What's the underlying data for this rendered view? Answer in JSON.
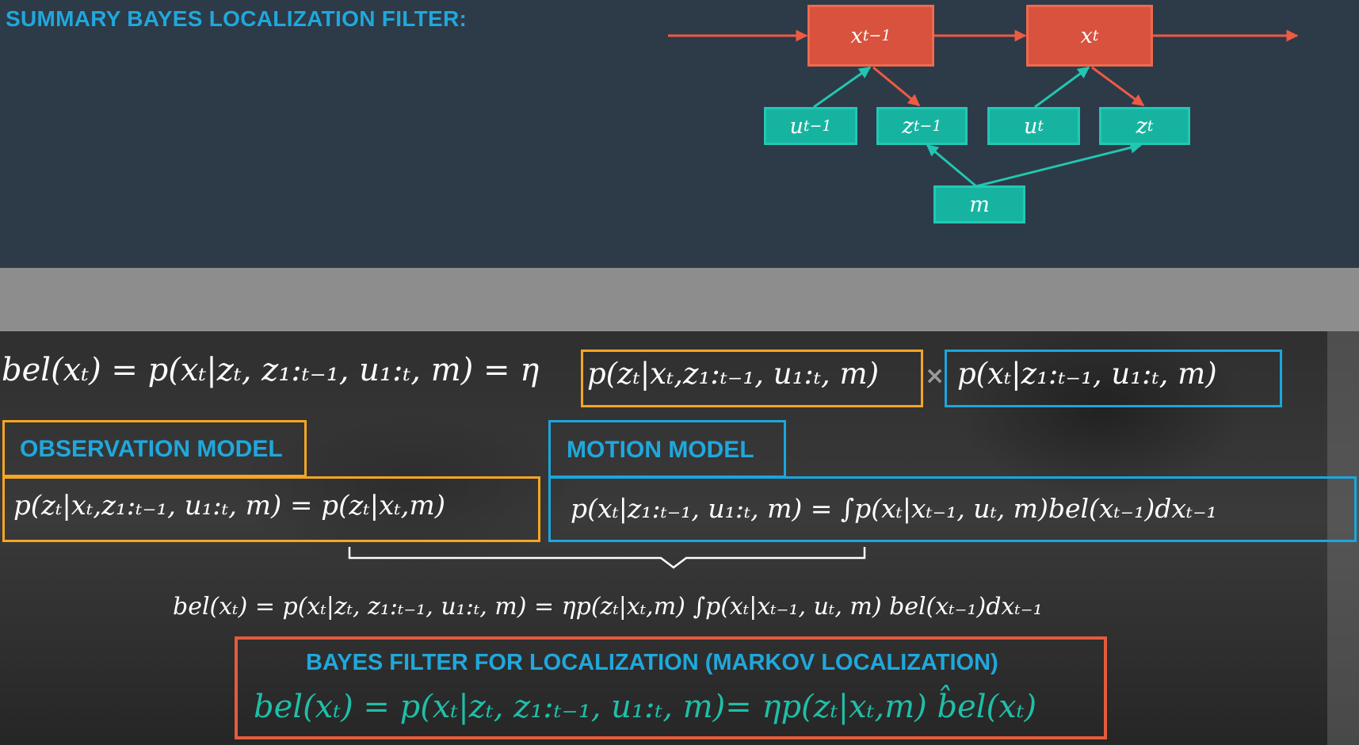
{
  "header": {
    "title": "SUMMARY BAYES LOCALIZATION FILTER:"
  },
  "diagram": {
    "nodes": {
      "x_prev": "x",
      "x_prev_sub": "t−1",
      "x_cur": "x",
      "x_cur_sub": "t",
      "u_prev": "u",
      "u_prev_sub": "t−1",
      "z_prev": "z",
      "z_prev_sub": "t−1",
      "u_cur": "u",
      "u_cur_sub": "t",
      "z_cur": "z",
      "z_cur_sub": "t",
      "m": "m"
    },
    "colors": {
      "state": "#d9523d",
      "observation": "#17b3a1",
      "state_arrow": "#ee5a43",
      "obs_arrow": "#22c6b0"
    }
  },
  "equations": {
    "main_lhs": "bel(xₜ) = p(xₜ|zₜ, z₁:ₜ₋₁, u₁:ₜ, m) = η",
    "main_obs": "p(zₜ|xₜ,z₁:ₜ₋₁, u₁:ₜ, m)",
    "main_times": "×",
    "main_motion": "p(xₜ|z₁:ₜ₋₁, u₁:ₜ, m)",
    "observation_label": "OBSERVATION MODEL",
    "observation_eq": "p(zₜ|xₜ,z₁:ₜ₋₁, u₁:ₜ, m) = p(zₜ|xₜ,m)",
    "motion_label": "MOTION MODEL",
    "motion_eq": "p(xₜ|z₁:ₜ₋₁, u₁:ₜ, m) = ∫p(xₜ|xₜ₋₁, uₜ, m)bel(xₜ₋₁)dxₜ₋₁",
    "combined_eq": "bel(xₜ) = p(xₜ|zₜ, z₁:ₜ₋₁, u₁:ₜ, m) = ηp(zₜ|xₜ,m) ∫p(xₜ|xₜ₋₁, uₜ, m) bel(xₜ₋₁)dxₜ₋₁",
    "final_label": "BAYES FILTER FOR LOCALIZATION (MARKOV LOCALIZATION)",
    "final_eq": "bel(xₜ) = p(xₜ|zₜ, z₁:ₜ₋₁, u₁:ₜ, m)= ηp(zₜ|xₜ,m) b̂el(xₜ)"
  },
  "colors": {
    "title_blue": "#1fa8dc",
    "orange": "#f5a623",
    "blue": "#1ba6dd",
    "red": "#e55b3c",
    "teal_text": "#1fbfa8"
  }
}
